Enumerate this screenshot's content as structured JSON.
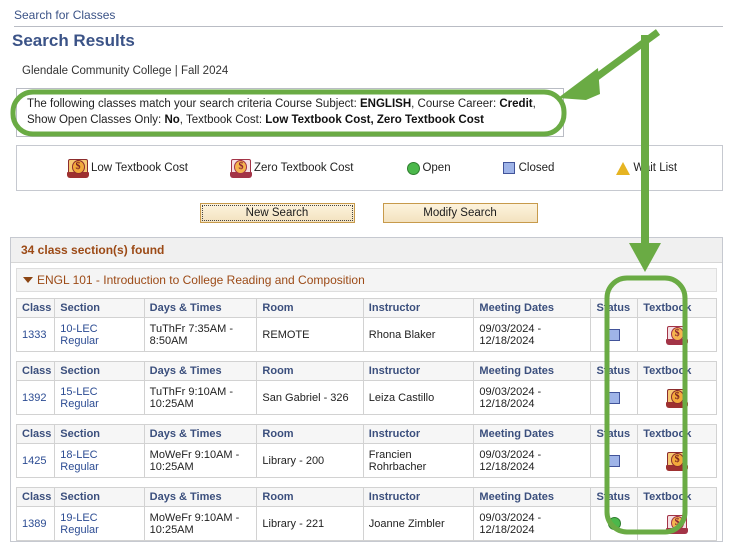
{
  "breadcrumb": {
    "link": "Search for Classes"
  },
  "header": {
    "title": "Search Results",
    "term_line": "Glendale Community College | Fall 2024"
  },
  "criteria": {
    "lead": "The following classes match your search criteria Course Subject:",
    "subject": "ENGLISH",
    "sep1": ",",
    "career_label": "Course Career:",
    "career": "Credit",
    "sep2": ",",
    "open_only_label": "Show Open Classes Only:",
    "open_only": "No",
    "sep3": ",",
    "textbook_label": "Textbook Cost:",
    "textbook_cost": "Low Textbook Cost, Zero Textbook Cost"
  },
  "legend": {
    "low": "Low Textbook Cost",
    "zero": "Zero Textbook Cost",
    "open": "Open",
    "closed": "Closed",
    "waitlist": "Wait List"
  },
  "buttons": {
    "new_search": "New Search",
    "modify_search": "Modify Search"
  },
  "results": {
    "count_text": "34 class section(s) found",
    "course_header": "ENGL 101 - Introduction to College Reading and Composition",
    "columns": [
      "Class",
      "Section",
      "Days & Times",
      "Room",
      "Instructor",
      "Meeting Dates",
      "Status",
      "Textbook"
    ],
    "rows": [
      {
        "class": "1333",
        "section_num": "10-LEC",
        "section_type": "Regular",
        "days_times": "TuThFr 7:35AM - 8:50AM",
        "room": "REMOTE",
        "instructor": "Rhona Blaker",
        "meeting_dates": "09/03/2024 - 12/18/2024",
        "status": "closed",
        "textbook": "zero"
      },
      {
        "class": "1392",
        "section_num": "15-LEC",
        "section_type": "Regular",
        "days_times": "TuThFr 9:10AM - 10:25AM",
        "room": "San Gabriel  - 326",
        "instructor": "Leiza Castillo",
        "meeting_dates": "09/03/2024 - 12/18/2024",
        "status": "closed",
        "textbook": "low"
      },
      {
        "class": "1425",
        "section_num": "18-LEC",
        "section_type": "Regular",
        "days_times": "MoWeFr 9:10AM - 10:25AM",
        "room": "Library  - 200",
        "instructor": "Francien Rohrbacher",
        "meeting_dates": "09/03/2024 - 12/18/2024",
        "status": "closed",
        "textbook": "low"
      },
      {
        "class": "1389",
        "section_num": "19-LEC",
        "section_type": "Regular",
        "days_times": "MoWeFr 9:10AM - 10:25AM",
        "room": "Library  - 221",
        "instructor": "Joanne Zimbler",
        "meeting_dates": "09/03/2024 - 12/18/2024",
        "status": "open",
        "textbook": "zero"
      }
    ]
  },
  "annotations": {
    "color": "#6aab44",
    "criteria_highlight": "rounded-rectangle around search criteria text",
    "criteria_arrow": "diagonal arrow pointing down-left to criteria box",
    "textbook_highlight": "rounded-rectangle around Textbook column",
    "textbook_arrow": "vertical arrow pointing down to Textbook column"
  },
  "icon_names": {
    "low": "low-textbook-cost-book-icon",
    "zero": "zero-textbook-cost-book-icon",
    "open": "open-status-green-circle-icon",
    "closed": "closed-status-blue-square-icon",
    "waitlist": "wait-list-yellow-triangle-icon"
  }
}
